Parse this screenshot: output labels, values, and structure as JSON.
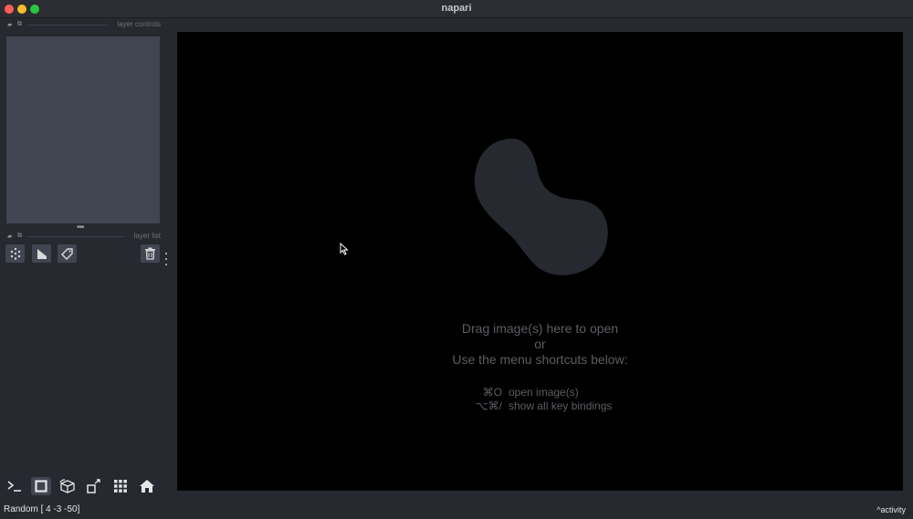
{
  "window": {
    "title": "napari"
  },
  "dock": {
    "layer_controls_label": "layer controls",
    "layer_list_label": "layer list"
  },
  "layer_buttons": [
    {
      "name": "new-points-layer",
      "icon": "points-icon"
    },
    {
      "name": "new-shapes-layer",
      "icon": "shapes-icon"
    },
    {
      "name": "new-labels-layer",
      "icon": "labels-icon"
    },
    {
      "name": "delete-layer",
      "icon": "trash-icon"
    }
  ],
  "bottom_buttons": [
    {
      "name": "console",
      "icon": "console-icon"
    },
    {
      "name": "ndisplay",
      "icon": "square-icon"
    },
    {
      "name": "roll-dims",
      "icon": "cube-icon"
    },
    {
      "name": "transpose-dims",
      "icon": "transpose-icon"
    },
    {
      "name": "grid-view",
      "icon": "grid-icon"
    },
    {
      "name": "reset-view",
      "icon": "home-icon"
    }
  ],
  "canvas": {
    "line1": "Drag image(s) here to open",
    "line2": "or",
    "line3": "Use the menu shortcuts below:",
    "shortcuts": [
      {
        "keys": "⌘O",
        "action": "open image(s)"
      },
      {
        "keys": "⌥⌘/",
        "action": "show all key bindings"
      }
    ]
  },
  "status": {
    "text": "Random [  4  -3 -50]",
    "activity": "activity"
  },
  "colors": {
    "background": "#262930",
    "panel": "#414551",
    "canvas": "#000000",
    "logo": "#262930",
    "text_muted": "#5b5e64"
  }
}
